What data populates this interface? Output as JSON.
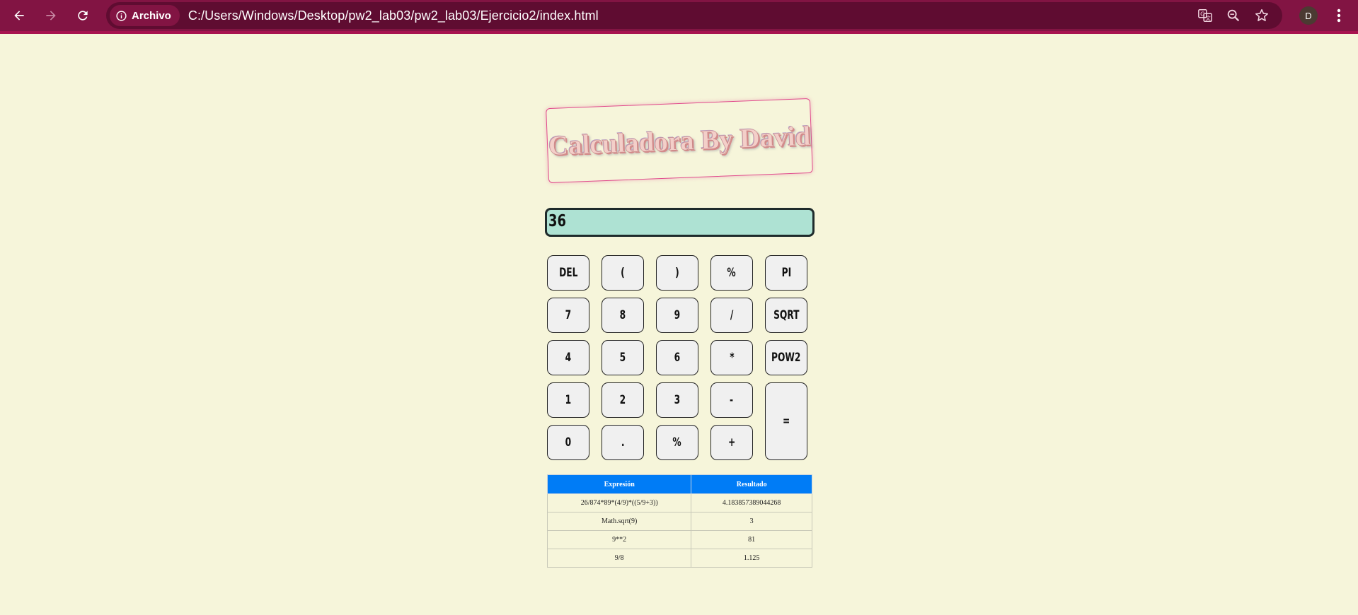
{
  "browser": {
    "security_chip": "Archivo",
    "url": "C:/Users/Windows/Desktop/pw2_lab03/pw2_lab03/Ejercicio2/index.html",
    "profile_initial": "D",
    "colors": {
      "toolbar": "#821443",
      "omnibox": "#5f0c31",
      "page_bg": "#f6f5da"
    },
    "icons": [
      "back-arrow-icon",
      "forward-arrow-icon",
      "reload-icon",
      "info-icon",
      "translate-icon",
      "zoom-icon",
      "star-icon",
      "more-menu-icon"
    ]
  },
  "calculator": {
    "title": "Calculadora By David",
    "display_value": "36",
    "keys": {
      "del": "DEL",
      "lparen": "(",
      "rparen": ")",
      "percent1": "%",
      "pi": "PI",
      "seven": "7",
      "eight": "8",
      "nine": "9",
      "divide": "/",
      "sqrt": "SQRT",
      "four": "4",
      "five": "5",
      "six": "6",
      "multiply": "*",
      "pow2": "POW2",
      "one": "1",
      "two": "2",
      "three": "3",
      "minus": "-",
      "equals": "=",
      "zero": "0",
      "dot": ".",
      "percent2": "%",
      "plus": "+"
    },
    "colors": {
      "display_bg": "#aee2d3",
      "table_header": "#007cf6",
      "title_border": "#e04a8c"
    }
  },
  "history": {
    "headers": [
      "Expresión",
      "Resultado"
    ],
    "rows": [
      [
        "26/874*89*(4/9)*((5/9+3))",
        "4.183857389044268"
      ],
      [
        "Math.sqrt(9)",
        "3"
      ],
      [
        "9**2",
        "81"
      ],
      [
        "9/8",
        "1.125"
      ]
    ]
  }
}
